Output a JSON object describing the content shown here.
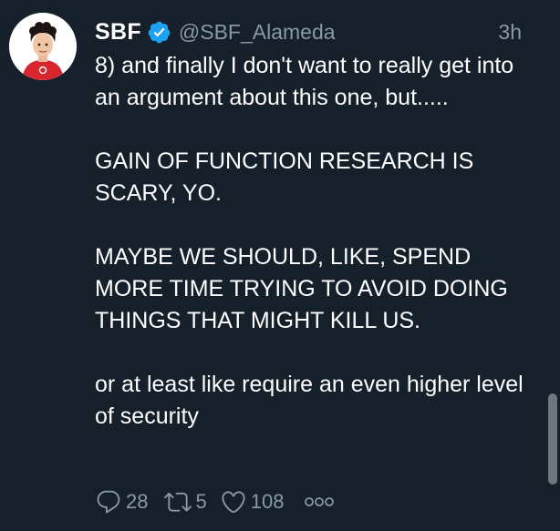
{
  "tweet": {
    "author": {
      "display_name": "SBF",
      "handle": "@SBF_Alameda",
      "verified": true
    },
    "timestamp": "3h",
    "text": "8) and finally I don't want to really get into an argument about this one, but.....\n\nGAIN OF FUNCTION RESEARCH IS SCARY, YO.\n\nMAYBE WE SHOULD, LIKE, SPEND MORE TIME TRYING TO AVOID DOING THINGS THAT MIGHT KILL US.\n\nor at least like require an even higher level of security",
    "actions": {
      "replies": "28",
      "retweets": "5",
      "likes": "108"
    }
  },
  "icons": {
    "verified": "verified-badge-icon",
    "reply": "reply-icon",
    "retweet": "retweet-icon",
    "like": "heart-icon",
    "more": "more-icon"
  },
  "colors": {
    "background": "#15202b",
    "text": "#ffffff",
    "secondary_text": "#8899a6",
    "verified_blue": "#1da1f2",
    "scrollbar_thumb": "#6e7780"
  }
}
